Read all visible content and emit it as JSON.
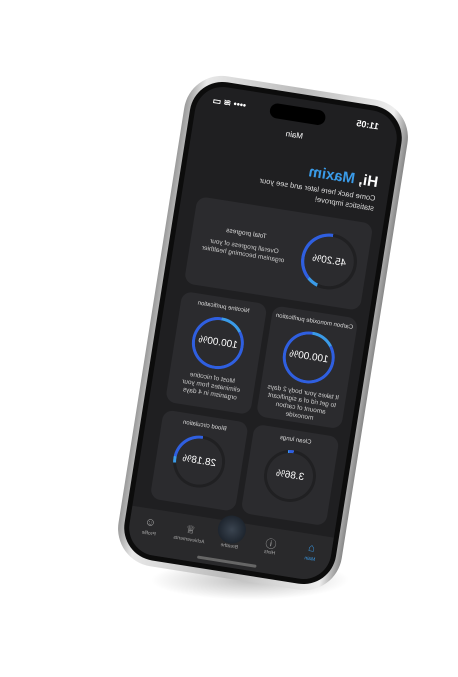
{
  "status": {
    "time": "11:05"
  },
  "header": {
    "title": "Main"
  },
  "greeting": {
    "hi": "Hi,",
    "name": "Maxim",
    "subtitle": "Come back here later and see your statistics improve!"
  },
  "total": {
    "title": "Total progress",
    "description": "Overall progress of your organism becoming healthier",
    "value": "45.20%",
    "percent": 45.2
  },
  "cards": [
    {
      "title": "Carbon monoxide purification",
      "value": "100.00%",
      "percent": 100,
      "description": "It takes your body 2 days to get rid of a significant amount of carbon monoxide"
    },
    {
      "title": "Nicotine purification",
      "value": "100.00%",
      "percent": 100,
      "description": "Most of nicotine eliminates from your organism in 4 days"
    },
    {
      "title": "Clean lungs",
      "value": "3.86%",
      "percent": 3.86
    },
    {
      "title": "Blood circulation",
      "value": "28.18%",
      "percent": 28.18
    }
  ],
  "tabs": [
    {
      "label": "Main",
      "icon": "home-icon"
    },
    {
      "label": "Hints",
      "icon": "hint-icon"
    },
    {
      "label": "Breathe",
      "icon": "breathe-icon"
    },
    {
      "label": "Achievements",
      "icon": "trophy-icon"
    },
    {
      "label": "Profile",
      "icon": "person-icon"
    }
  ],
  "colors": {
    "accent": "#3a9be8",
    "ring": "#2f5fe0",
    "track": "#202022"
  }
}
